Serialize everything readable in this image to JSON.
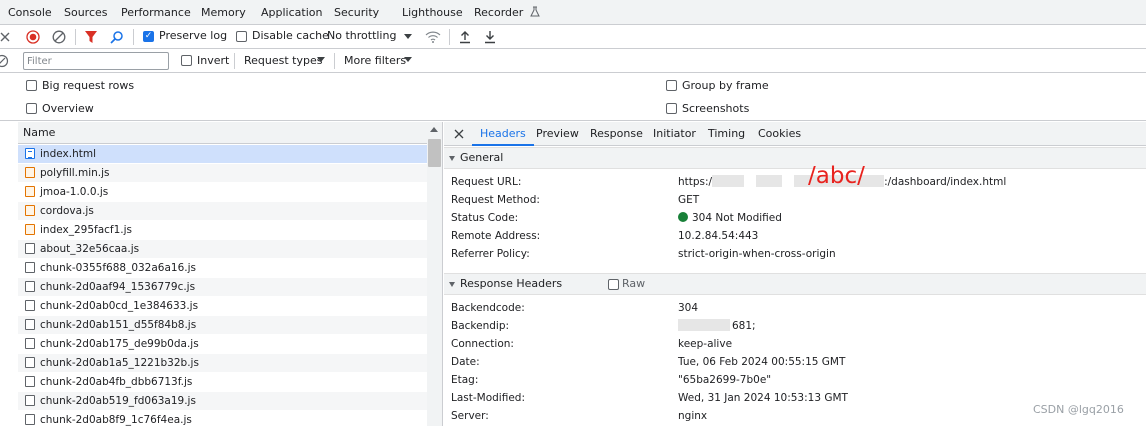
{
  "top_tabs": [
    "Console",
    "Sources",
    "Performance",
    "Memory",
    "Application",
    "Security",
    "Lighthouse",
    "Recorder"
  ],
  "toolbar": {
    "preserve_log_label": "Preserve log",
    "preserve_log_checked": true,
    "disable_cache_label": "Disable cache",
    "throttling_value": "No throttling"
  },
  "filter": {
    "placeholder": "Filter",
    "invert_label": "Invert",
    "request_types_label": "Request types",
    "more_filters_label": "More filters"
  },
  "settings": {
    "big_request_rows": "Big request rows",
    "overview": "Overview",
    "group_by_frame": "Group by frame",
    "screenshots": "Screenshots"
  },
  "list": {
    "header": "Name",
    "rows": [
      {
        "name": "index.html",
        "type": "doc",
        "selected": true
      },
      {
        "name": "polyfill.min.js",
        "type": "js"
      },
      {
        "name": "jmoa-1.0.0.js",
        "type": "js"
      },
      {
        "name": "cordova.js",
        "type": "js"
      },
      {
        "name": "index_295facf1.js",
        "type": "js"
      },
      {
        "name": "about_32e56caa.js",
        "type": "gen"
      },
      {
        "name": "chunk-0355f688_032a6a16.js",
        "type": "gen"
      },
      {
        "name": "chunk-2d0aaf94_1536779c.js",
        "type": "gen"
      },
      {
        "name": "chunk-2d0ab0cd_1e384633.js",
        "type": "gen"
      },
      {
        "name": "chunk-2d0ab151_d55f84b8.js",
        "type": "gen"
      },
      {
        "name": "chunk-2d0ab175_de99b0da.js",
        "type": "gen"
      },
      {
        "name": "chunk-2d0ab1a5_1221b32b.js",
        "type": "gen"
      },
      {
        "name": "chunk-2d0ab4fb_dbb6713f.js",
        "type": "gen"
      },
      {
        "name": "chunk-2d0ab519_fd063a19.js",
        "type": "gen"
      },
      {
        "name": "chunk-2d0ab8f9_1c76f4ea.js",
        "type": "gen"
      }
    ]
  },
  "detail": {
    "tabs": [
      "Headers",
      "Preview",
      "Response",
      "Initiator",
      "Timing",
      "Cookies"
    ],
    "active_tab": "Headers",
    "general": {
      "title": "General",
      "rows": [
        {
          "key": "Request URL:",
          "value_prefix": "https:/",
          "value_suffix": ":/dashboard/index.html"
        },
        {
          "key": "Request Method:",
          "value": "GET"
        },
        {
          "key": "Status Code:",
          "value": "304 Not Modified"
        },
        {
          "key": "Remote Address:",
          "value": "10.2.84.54:443"
        },
        {
          "key": "Referrer Policy:",
          "value": "strict-origin-when-cross-origin"
        }
      ],
      "annotation": "/abc/"
    },
    "response_headers": {
      "title": "Response Headers",
      "raw_label": "Raw",
      "rows": [
        {
          "key": "Backendcode:",
          "value": "304"
        },
        {
          "key": "Backendip:",
          "value": "681;"
        },
        {
          "key": "Connection:",
          "value": "keep-alive"
        },
        {
          "key": "Date:",
          "value": "Tue, 06 Feb 2024 00:55:15 GMT"
        },
        {
          "key": "Etag:",
          "value": "\"65ba2699-7b0e\""
        },
        {
          "key": "Last-Modified:",
          "value": "Wed, 31 Jan 2024 10:53:13 GMT"
        },
        {
          "key": "Server:",
          "value": "nginx"
        }
      ]
    }
  },
  "watermark": "CSDN @lgq2016",
  "colors": {
    "accent": "#1a73e8",
    "record": "#d93025",
    "status_ok": "#188038",
    "annotation": "#e8231f"
  }
}
